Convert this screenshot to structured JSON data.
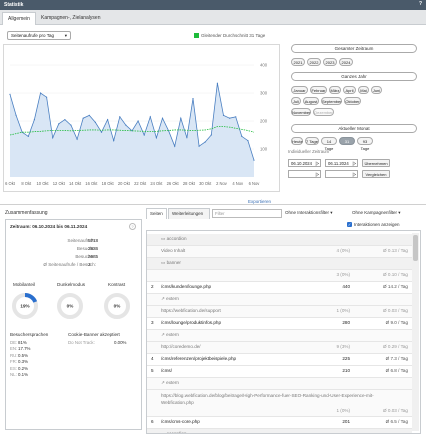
{
  "window": {
    "title": "Statistik",
    "help": "?"
  },
  "tabs": [
    {
      "label": "Allgemein"
    },
    {
      "label": "Kampagnen-, Zielanalysen"
    }
  ],
  "chart_controls": {
    "metric_select": "Seitenaufrufe pro Tag",
    "legend": "Gleitender Durchschnitt 31 Tage"
  },
  "chart_data": {
    "type": "line",
    "x_ticks": [
      "6 Okt",
      "8 Okt",
      "10 Okt",
      "12 Okt",
      "14 Okt",
      "16 Okt",
      "18 Okt",
      "20 Okt",
      "22 Okt",
      "24 Okt",
      "26 Okt",
      "28 Okt",
      "30 Okt",
      "2 Nov",
      "4 Nov",
      "6 Nov"
    ],
    "y_ticks": [
      400,
      300,
      200,
      100
    ],
    "ylim": [
      0,
      450
    ],
    "series": [
      {
        "color": "#4a7fc1",
        "fill": "#d9e6f5",
        "values": [
          295,
          220,
          160,
          145,
          205,
          300,
          285,
          140,
          190,
          205,
          185,
          135,
          210,
          220,
          195,
          160,
          205,
          130,
          215,
          185,
          165,
          200,
          150,
          215,
          140,
          210,
          165,
          110,
          210,
          140,
          280,
          110,
          125,
          150,
          335,
          220,
          210,
          215,
          145,
          130,
          60
        ]
      },
      {
        "color": "#1dbb3a",
        "values": [
          150,
          155,
          160,
          160,
          162,
          163,
          165,
          166,
          166,
          166,
          165,
          166,
          167,
          168,
          168,
          167,
          168,
          168,
          167,
          166,
          165,
          164,
          163,
          163,
          163,
          165,
          166,
          168,
          168,
          167,
          166,
          167,
          168,
          172,
          180,
          180,
          178,
          174,
          170,
          166,
          160
        ]
      }
    ]
  },
  "right_panel": {
    "total": {
      "title": "Gesamter Zeitraum",
      "years": [
        "2021",
        "2022",
        "2023",
        "2024"
      ]
    },
    "year": {
      "title": "Ganzes Jahr",
      "months": [
        "Januar",
        "Februar",
        "März",
        "April",
        "Mai",
        "Juni",
        "Juli",
        "August",
        "September",
        "Oktober",
        "November",
        "Dezember"
      ]
    },
    "month": {
      "title": "Aktueller Monat",
      "options": [
        "Heute",
        "7 Tage",
        "14 Tage",
        "31 Tage",
        "93 Tage"
      ]
    },
    "custom": {
      "label": "Individueller Zeitraum",
      "from": "06.10.2024",
      "to": "06.11.2024",
      "apply": "Übernehmen",
      "compare": "Vergleichen",
      "arrow": "|>"
    }
  },
  "export_link": "Exportieren",
  "summary": {
    "title": "Zusammenfassung",
    "period": "Zeitraum: 06.10.2024 bis 06.11.2024",
    "stats": [
      {
        "label": "Seitenaufrufe:",
        "value": "5718"
      },
      {
        "label": "Besuche:",
        "value": "2836"
      },
      {
        "label": "Besucher:",
        "value": "2685"
      },
      {
        "label": "Ø Seitenaufrufe / Besuch:",
        "value": "2"
      }
    ],
    "gauges": [
      {
        "title": "Mobilanteil",
        "value": "19%",
        "fraction": 0.19
      },
      {
        "title": "Dunkelmodus",
        "value": "0%",
        "fraction": 0
      },
      {
        "title": "Kontrast",
        "value": "0%",
        "fraction": 0
      }
    ],
    "languages_title": "Besuchersprachen",
    "languages": [
      {
        "code": "DE:",
        "value": "81%"
      },
      {
        "code": "EN:",
        "value": "17.7%"
      },
      {
        "code": "RU:",
        "value": "0.5%"
      },
      {
        "code": "FR:",
        "value": "0.3%"
      },
      {
        "code": "ES:",
        "value": "0.2%"
      },
      {
        "code": "NL:",
        "value": "0.1%"
      }
    ],
    "cookie_title": "Cookie-Banner akzeptiert",
    "cookie": {
      "label": "Do Not Track:",
      "value": "0.00%"
    }
  },
  "table": {
    "tabs": [
      "Seiten",
      "Weiterleitungen"
    ],
    "filter_placeholder": "Filter",
    "dropdown1": "Ohne Interaktionsfilter",
    "dropdown2": "Ohne Kampagnenfilter",
    "checkbox": "Interaktionen anzeigen",
    "rows": [
      {
        "num": "",
        "name": "accordion",
        "val": "",
        "avg": "",
        "sub": true,
        "icon": "▭"
      },
      {
        "num": "",
        "name": "Video Inhalt",
        "val": "4 (0%)",
        "avg": "Ø 0.13 / Tag",
        "sub": true,
        "icon": ""
      },
      {
        "num": "",
        "name": "banner",
        "val": "",
        "avg": "",
        "sub": true,
        "icon": "▭"
      },
      {
        "num": "",
        "name": "",
        "val": "3 (0%)",
        "avg": "Ø 0.10 / Tag",
        "sub": true,
        "icon": ""
      },
      {
        "num": "2",
        "name": "/cms/kunden/lounge.php",
        "val": "440",
        "avg": "Ø 14.2 / Tag",
        "sub": false,
        "icon": ""
      },
      {
        "num": "",
        "name": "extern",
        "val": "",
        "avg": "",
        "sub": true,
        "icon": "↗"
      },
      {
        "num": "",
        "name": "https://webfication.de/support",
        "val": "1 (0%)",
        "avg": "Ø 0.03 / Tag",
        "sub": true,
        "icon": ""
      },
      {
        "num": "3",
        "name": "/cms/lounge/produktinfos.php",
        "val": "280",
        "avg": "Ø 9.0 / Tag",
        "sub": false,
        "icon": ""
      },
      {
        "num": "",
        "name": "extern",
        "val": "",
        "avg": "",
        "sub": true,
        "icon": "↗"
      },
      {
        "num": "",
        "name": "http://coredemo.de/",
        "val": "9 (3%)",
        "avg": "Ø 0.29 / Tag",
        "sub": true,
        "icon": ""
      },
      {
        "num": "4",
        "name": "/cms/referenzen/projektbeispiele.php",
        "val": "225",
        "avg": "Ø 7.3 / Tag",
        "sub": false,
        "icon": ""
      },
      {
        "num": "5",
        "name": "/cms/",
        "val": "210",
        "avg": "Ø 6.8 / Tag",
        "sub": false,
        "icon": ""
      },
      {
        "num": "",
        "name": "extern",
        "val": "",
        "avg": "",
        "sub": true,
        "icon": "↗"
      },
      {
        "num": "",
        "name": "https://blog.webfication.de/blog/beitrage/High-Performance-fuer-SEO-Ranking-und-User-Experience-mit-Webfication.php",
        "val": "1 (0%)",
        "avg": "Ø 0.03 / Tag",
        "sub": true,
        "icon": "",
        "wrap": true
      },
      {
        "num": "6",
        "name": "/cms/cms-core.php",
        "val": "201",
        "avg": "Ø 6.5 / Tag",
        "sub": false,
        "icon": ""
      },
      {
        "num": "",
        "name": "accordion",
        "val": "",
        "avg": "",
        "sub": true,
        "icon": "▭"
      }
    ]
  }
}
